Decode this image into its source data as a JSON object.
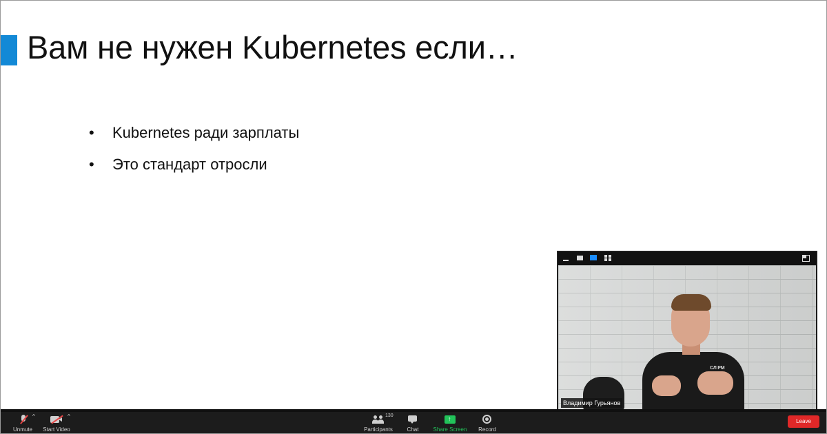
{
  "colors": {
    "accent": "#1389d6",
    "share_green": "#22c35a",
    "leave_red": "#e02828",
    "toolbar_bg": "#1c1c1c"
  },
  "slide": {
    "title": "Вам не нужен Kubernetes если…",
    "bullet_glyph": "•",
    "bullets": [
      "Kubernetes ради зарплаты",
      "Это стандарт отросли"
    ]
  },
  "video_panel": {
    "participant_name": "Владимир Гурьянов",
    "shirt_logo": "СЛ РМ",
    "view_icons": [
      "minimize-icon",
      "speaker-view-icon",
      "active-view-icon",
      "gallery-view-icon",
      "exit-fullscreen-icon"
    ]
  },
  "toolbar": {
    "unmute": "Unmute",
    "start_video": "Start Video",
    "caret": "^",
    "participants": "Participants",
    "participants_count": "130",
    "chat": "Chat",
    "share_screen": "Share Screen",
    "share_arrow": "↑",
    "record": "Record",
    "leave": "Leave"
  }
}
